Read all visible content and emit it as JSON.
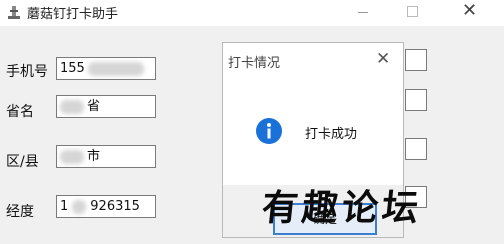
{
  "window": {
    "title": "蘑菇钉打卡助手"
  },
  "form": {
    "phone_label": "手机号",
    "phone_value": "155",
    "province_label": "省名",
    "province_value": "省",
    "district_label": "区/县",
    "district_value": "市",
    "longitude_label": "经度",
    "longitude_prefix": "1",
    "longitude_value": "926315"
  },
  "dialog": {
    "title": "打卡情况",
    "message": "打卡成功",
    "ok_label": "确定",
    "icon": "info-icon"
  },
  "watermark": {
    "text": "有趣论坛"
  },
  "colors": {
    "accent": "#1a72d8",
    "border": "#7a7a7a"
  }
}
